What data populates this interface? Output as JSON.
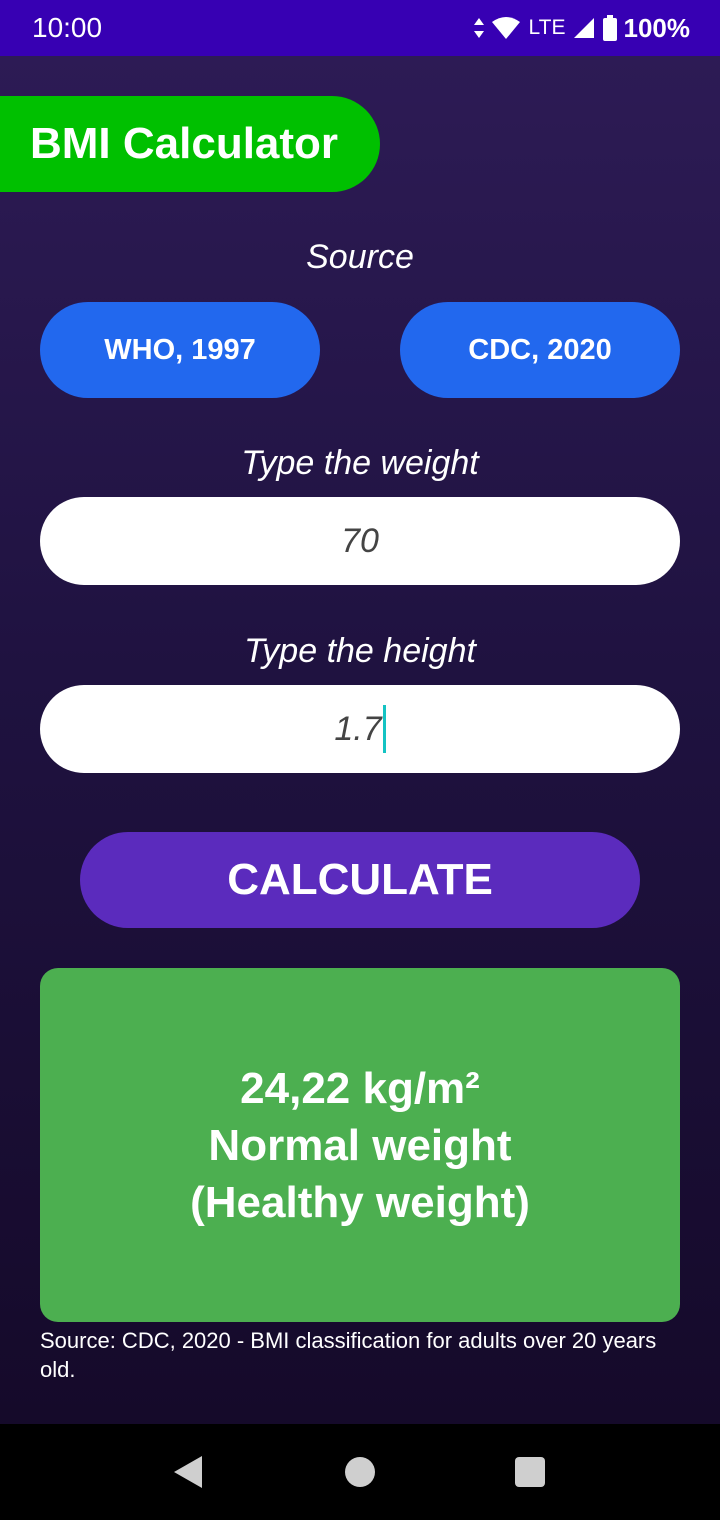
{
  "status_bar": {
    "time": "10:00",
    "network": "LTE",
    "battery": "100%",
    "icons": [
      "data-arrows-icon",
      "wifi-icon",
      "signal-icon",
      "battery-icon"
    ]
  },
  "app": {
    "title": "BMI Calculator",
    "source_label": "Source",
    "source_options": [
      "WHO, 1997",
      "CDC, 2020"
    ],
    "weight_label": "Type the weight",
    "weight_value": "70",
    "height_label": "Type the height",
    "height_value": "1.7",
    "calculate_label": "CALCULATE",
    "result": {
      "value": "24,22 kg/m²",
      "category": "Normal weight",
      "detail": "(Healthy weight)"
    },
    "source_note": "Source: CDC, 2020 - BMI classification for adults over 20 years old."
  },
  "colors": {
    "status_bar": "#3700b3",
    "title_pill": "#00c000",
    "source_button": "#2268ee",
    "calculate_button": "#5b2bbd",
    "result_box": "#4caf50"
  },
  "nav_bar": {
    "icons": [
      "back-icon",
      "home-icon",
      "recents-icon"
    ]
  }
}
